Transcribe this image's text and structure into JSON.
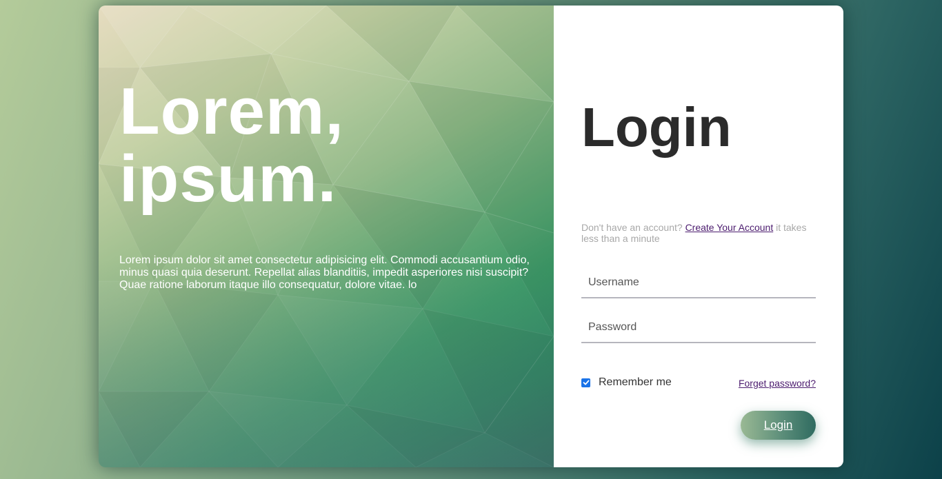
{
  "hero": {
    "title_line1": "Lorem,",
    "title_line2": "ipsum.",
    "text": "Lorem ipsum dolor sit amet consectetur adipisicing elit. Commodi accusantium odio, minus quasi quia deserunt. Repellat alias blanditiis, impedit asperiores nisi suscipit? Quae ratione laborum itaque illo consequatur, dolore vitae. lo"
  },
  "login": {
    "title": "Login",
    "signup_prefix": "Don't have an account?",
    "signup_link": "Create Your Account",
    "signup_suffix": "it takes less than a minute",
    "username_placeholder": "Username",
    "password_placeholder": "Password",
    "remember_label": "Remember me",
    "remember_checked": true,
    "forgot_link": "Forget password?",
    "submit_label": "Login"
  },
  "colors": {
    "link": "#4b1b6e",
    "checkbox": "#1a73e8",
    "title": "#2b2b2b"
  }
}
